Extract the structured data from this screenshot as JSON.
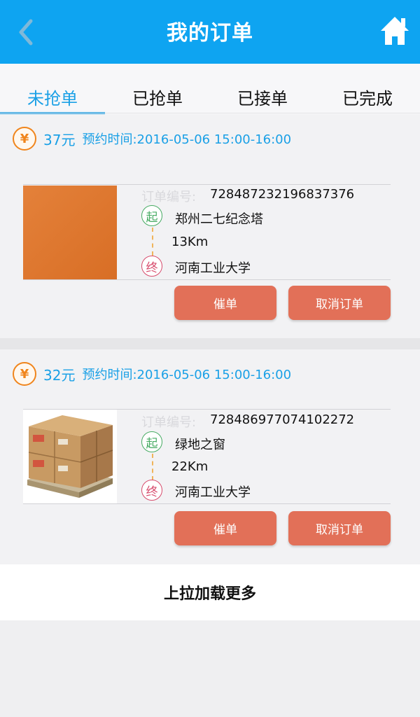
{
  "header": {
    "title": "我的订单",
    "back_icon": "chevron-left-icon",
    "home_icon": "home-icon",
    "color": "#0ea4f1"
  },
  "tabs": [
    {
      "label": "未抢单",
      "active": true
    },
    {
      "label": "已抢单",
      "active": false
    },
    {
      "label": "已接单",
      "active": false
    },
    {
      "label": "已完成",
      "active": false
    }
  ],
  "orders": [
    {
      "currency_symbol": "¥",
      "price": "37元",
      "appointment": "预约时间:2016-05-06 15:00-16:00",
      "order_no_label": "订单编号:",
      "order_no": "728487232196837376",
      "start_badge": "起",
      "start": "郑州二七纪念塔",
      "distance": "13Km",
      "end_badge": "终",
      "end": "河南工业大学",
      "thumbnail": "orange-placeholder-image",
      "urge_label": "催单",
      "cancel_label": "取消订单"
    },
    {
      "currency_symbol": "¥",
      "price": "32元",
      "appointment": "预约时间:2016-05-06 15:00-16:00",
      "order_no_label": "订单编号:",
      "order_no": "728486977074102272",
      "start_badge": "起",
      "start": "绿地之窗",
      "distance": "22Km",
      "end_badge": "终",
      "end": "河南工业大学",
      "thumbnail": "cardboard-boxes-on-pallet-image",
      "urge_label": "催单",
      "cancel_label": "取消订单"
    }
  ],
  "load_more": "上拉加载更多",
  "colors": {
    "accent": "#1aa0e6",
    "button": "#e27058",
    "yen": "#f0851c",
    "start": "#47ab63",
    "end": "#d74b6c"
  }
}
